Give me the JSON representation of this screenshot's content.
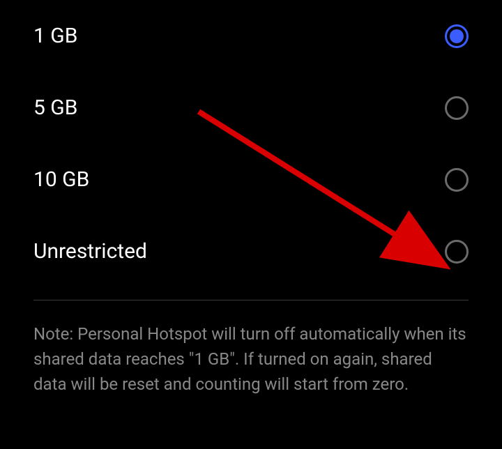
{
  "options": [
    {
      "label": "1 GB",
      "selected": true
    },
    {
      "label": "5 GB",
      "selected": false
    },
    {
      "label": "10 GB",
      "selected": false
    },
    {
      "label": "Unrestricted",
      "selected": false
    }
  ],
  "note": "Note: Personal Hotspot will turn off automatically when its shared data reaches \"1 GB\". If turned on again, shared data will be reset and counting will start from zero.",
  "annotation": {
    "arrow_color": "#d80000"
  }
}
